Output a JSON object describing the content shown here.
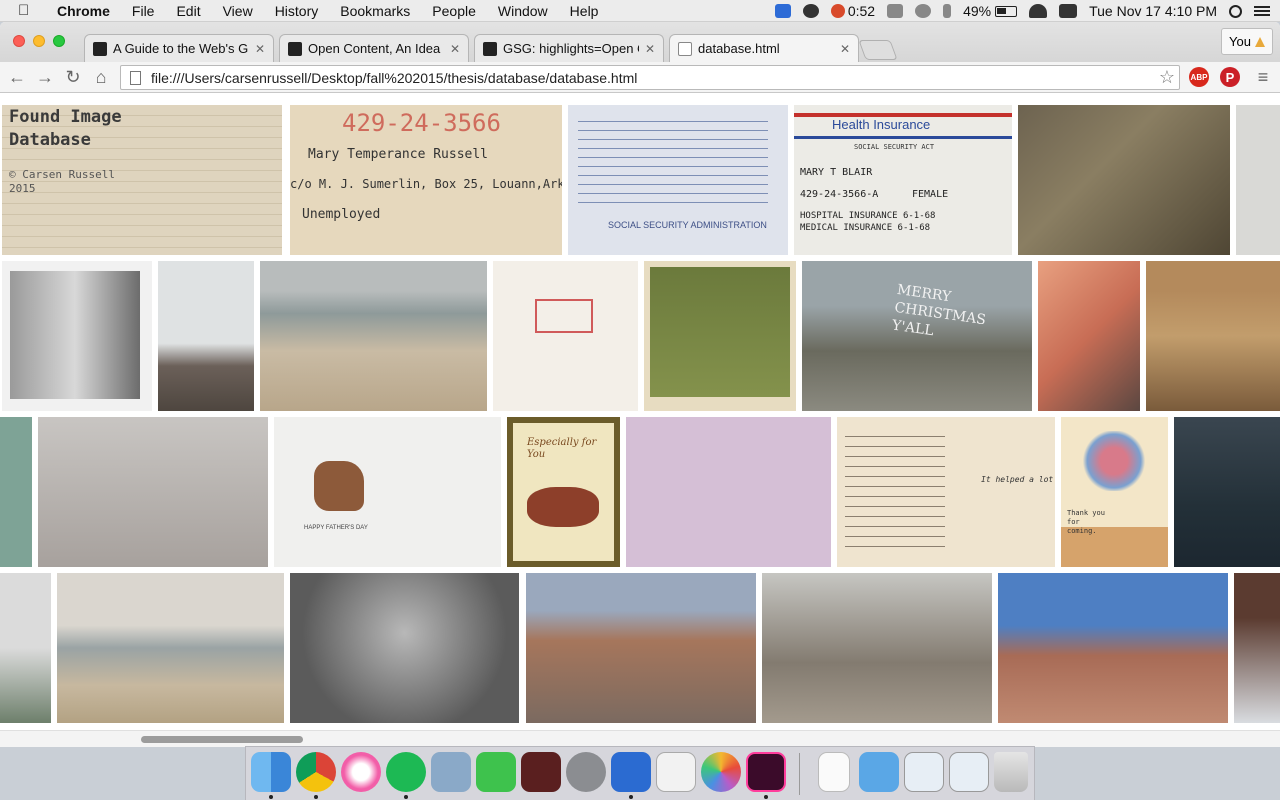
{
  "menubar": {
    "app_name": "Chrome",
    "items": [
      "File",
      "Edit",
      "View",
      "History",
      "Bookmarks",
      "People",
      "Window",
      "Help"
    ],
    "timer": "0:52",
    "battery": "49%",
    "clock": "Tue Nov 17  4:10 PM"
  },
  "tabs": [
    {
      "label": "A Guide to the Web's Grow",
      "active": false
    },
    {
      "label": "Open Content, An Idea Wh",
      "active": false
    },
    {
      "label": "GSG: highlights=Open Con",
      "active": false
    },
    {
      "label": "database.html",
      "active": true
    }
  ],
  "profile_label": "You",
  "address_bar": {
    "url": "file:///Users/carsenrussell/Desktop/fall%202015/thesis/database/database.html"
  },
  "extensions": {
    "abp": "ABP"
  },
  "page": {
    "title_line1": "Found Image",
    "title_line2": "Database",
    "credit_line1": "© Carsen Russell",
    "credit_line2": "2015"
  },
  "tile_text": {
    "ssn_number": "429-24-3566",
    "ssn_name": "Mary Temperance Russell",
    "ssn_address": "c/o M. J. Sumerlin, Box 25, Louann,Ark.",
    "ssn_employer": "Unemployed",
    "ssa_card_footer": "SOCIAL SECURITY ADMINISTRATION",
    "hi_title": "Health Insurance",
    "hi_act": "SOCIAL SECURITY ACT",
    "hi_name": "MARY T BLAIR",
    "hi_claim": "429-24-3566-A",
    "hi_sex": "FEMALE",
    "hi_hospital": "HOSPITAL INSURANCE   6-1-68",
    "hi_medical": "MEDICAL  INSURANCE   6-1-68",
    "xmas_sign": "MERRY CHRISTMAS Y'ALL",
    "card_cover": "Especially for You",
    "card_inside": "HAPPY FATHER'S DAY",
    "note_text": "It helped a lot",
    "thank_you": "Thank you for coming."
  },
  "dock": {
    "apps": [
      "finder-icon",
      "chrome-icon",
      "itunes-icon",
      "spotify-icon",
      "mail-icon",
      "facetime-icon",
      "photo-booth-icon",
      "system-preferences-icon",
      "word-icon",
      "textedit-icon",
      "photos-icon",
      "indesign-icon",
      "document-icon",
      "folder-icon",
      "downloads-stack-icon",
      "screenshot-stack-icon",
      "trash-icon"
    ]
  }
}
